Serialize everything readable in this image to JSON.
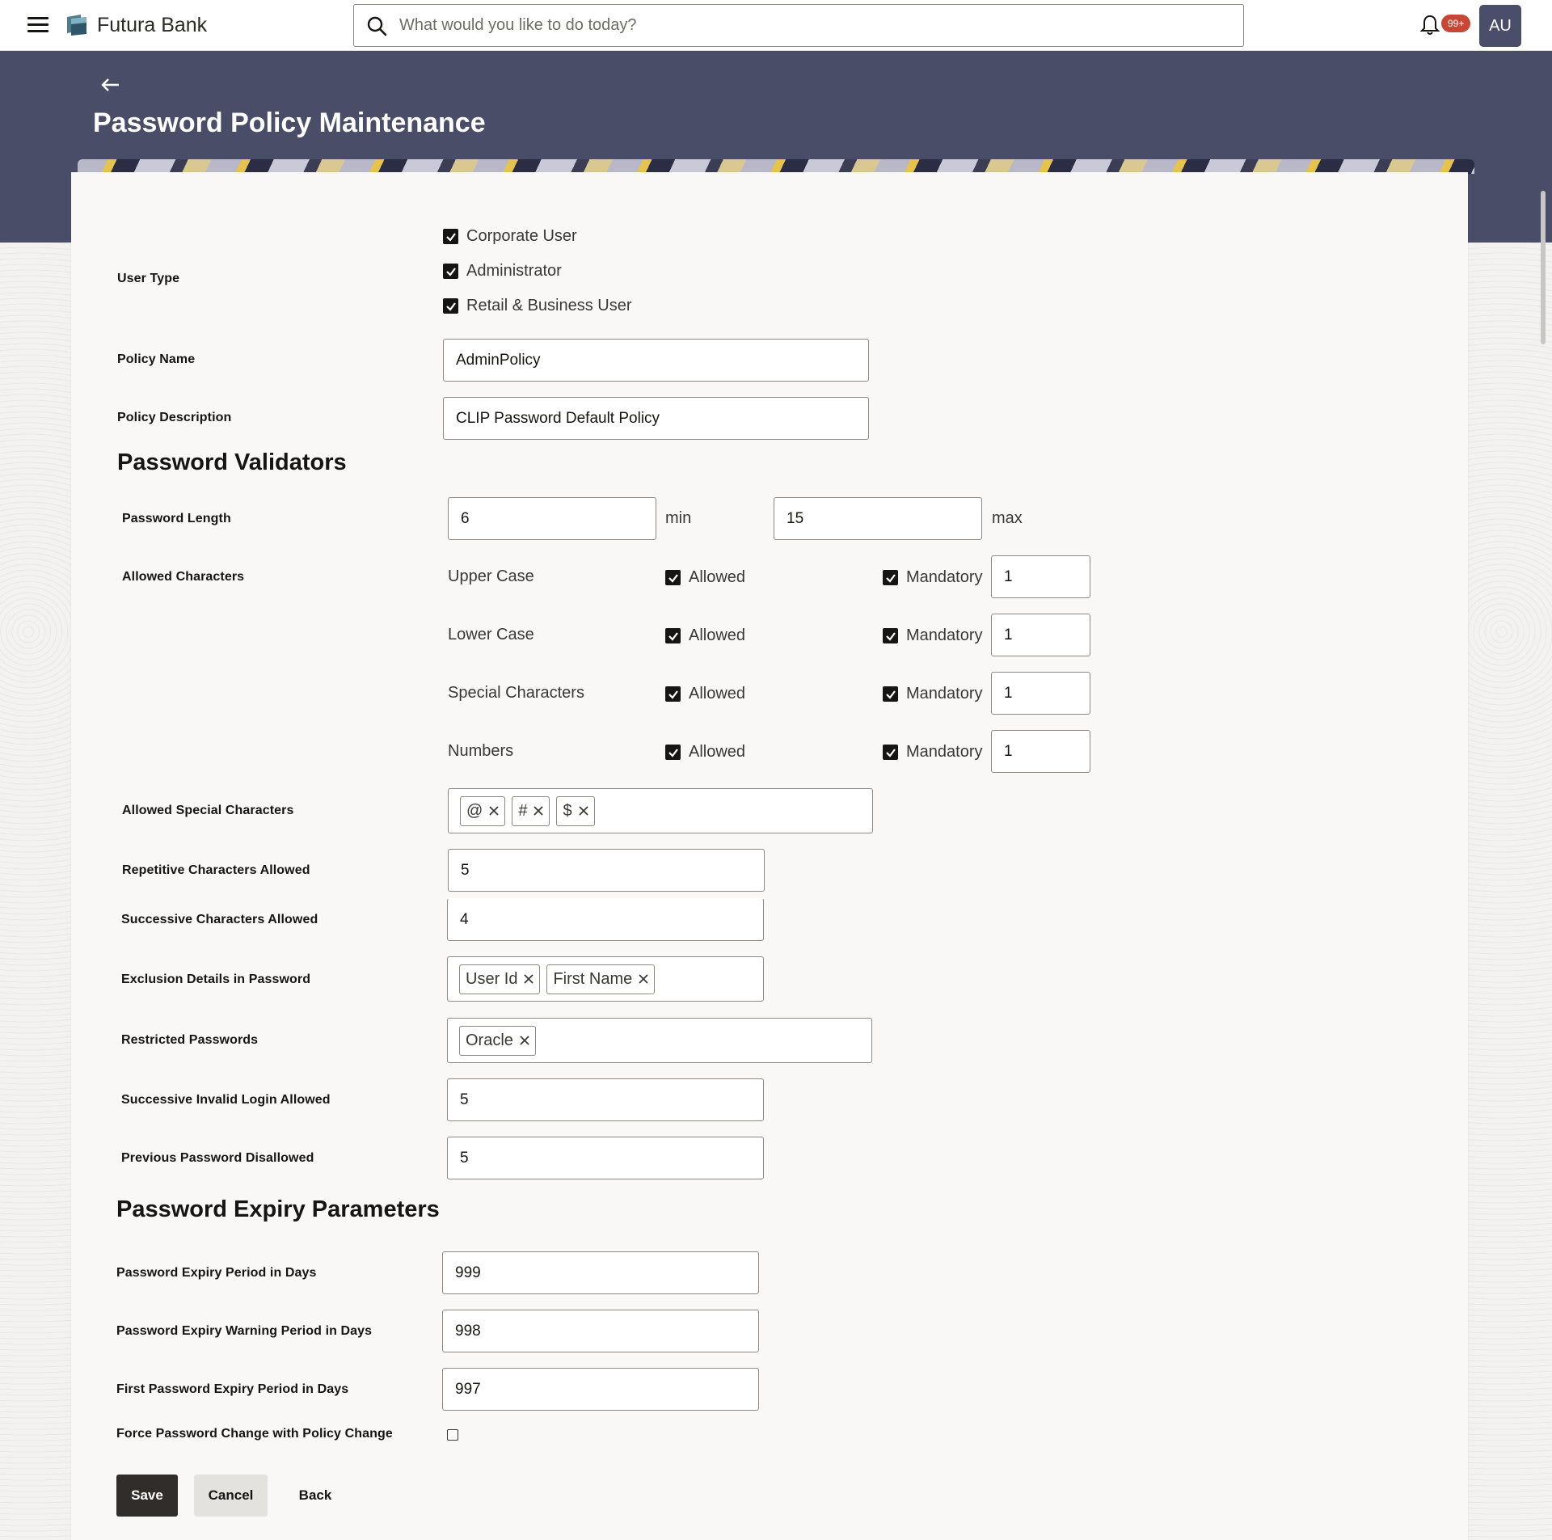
{
  "header": {
    "brand": "Futura Bank",
    "search_placeholder": "What would you like to do today?",
    "notification_count": "99+",
    "avatar_initials": "AU"
  },
  "page": {
    "title": "Password Policy Maintenance"
  },
  "user_type": {
    "label": "User Type",
    "options": [
      {
        "label": "Corporate User",
        "checked": true
      },
      {
        "label": "Administrator",
        "checked": true
      },
      {
        "label": "Retail & Business User",
        "checked": true
      }
    ]
  },
  "policy": {
    "name_label": "Policy Name",
    "name_value": "AdminPolicy",
    "description_label": "Policy Description",
    "description_value": "CLIP Password Default Policy"
  },
  "validators": {
    "title": "Password Validators",
    "length_label": "Password Length",
    "length_min": "6",
    "min_text": "min",
    "length_max": "15",
    "max_text": "max",
    "allowed_chars_label": "Allowed Characters",
    "allowed_text": "Allowed",
    "mandatory_text": "Mandatory",
    "char_rows": [
      {
        "name": "Upper Case",
        "allowed": true,
        "mandatory": true,
        "count": "1"
      },
      {
        "name": "Lower Case",
        "allowed": true,
        "mandatory": true,
        "count": "1"
      },
      {
        "name": "Special Characters",
        "allowed": true,
        "mandatory": true,
        "count": "1"
      },
      {
        "name": "Numbers",
        "allowed": true,
        "mandatory": true,
        "count": "1"
      }
    ],
    "special_chars_label": "Allowed Special Characters",
    "special_chars": [
      "@",
      "#",
      "$"
    ],
    "repetitive_label": "Repetitive Characters Allowed",
    "repetitive_value": "5",
    "successive_label": "Successive Characters Allowed",
    "successive_value": "4",
    "exclusion_label": "Exclusion Details in Password",
    "exclusions": [
      "User Id",
      "First Name"
    ],
    "restricted_label": "Restricted Passwords",
    "restricted": [
      "Oracle"
    ],
    "invalid_login_label": "Successive Invalid Login Allowed",
    "invalid_login_value": "5",
    "previous_label": "Previous Password Disallowed",
    "previous_value": "5"
  },
  "expiry": {
    "title": "Password Expiry Parameters",
    "period_label": "Password Expiry Period in Days",
    "period_value": "999",
    "warning_label": "Password Expiry Warning Period in Days",
    "warning_value": "998",
    "first_label": "First Password Expiry Period in Days",
    "first_value": "997",
    "force_label": "Force Password Change with Policy Change",
    "force_checked": false
  },
  "actions": {
    "save": "Save",
    "cancel": "Cancel",
    "back": "Back"
  },
  "colors": {
    "banner": "#4a4d68",
    "primary_button": "#312d2a",
    "badge": "#c74634",
    "avatar": "#4a4e6a"
  }
}
